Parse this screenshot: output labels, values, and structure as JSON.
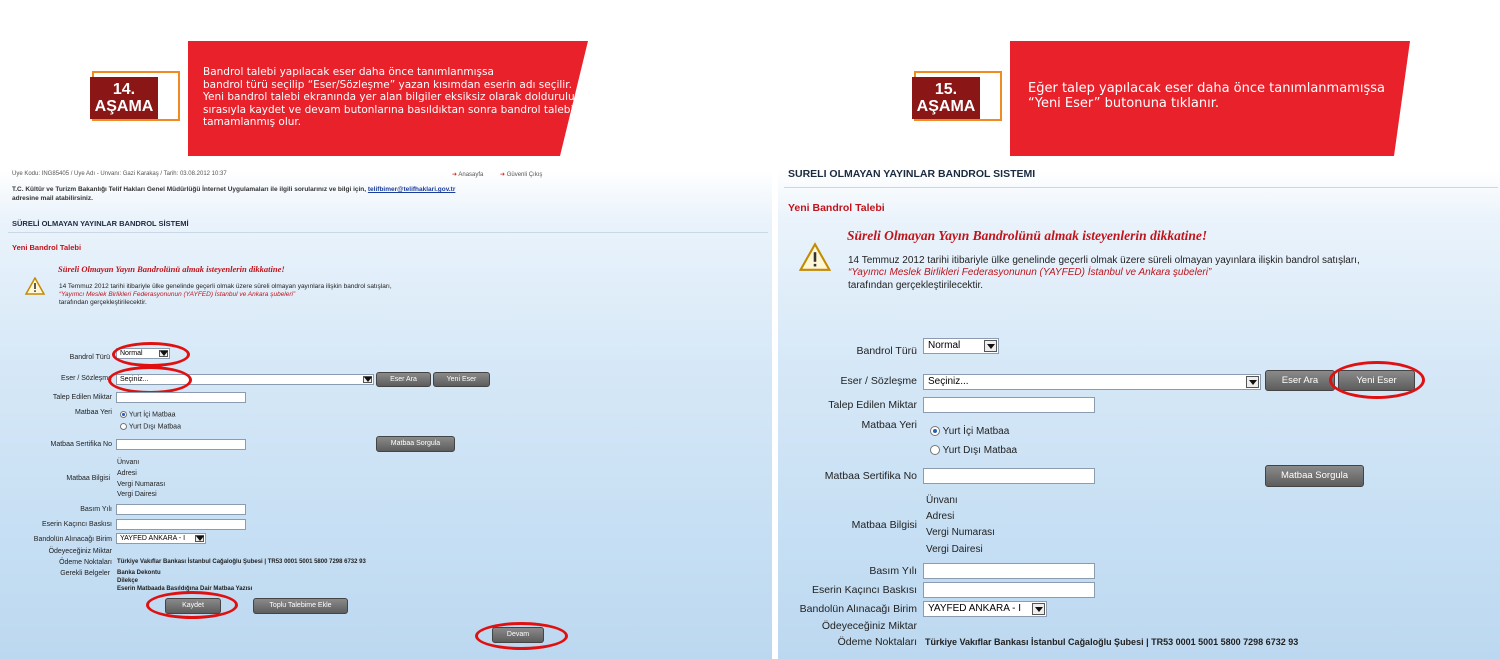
{
  "step14": {
    "badge_num": "14.",
    "badge_text": "AŞAMA",
    "banner": "Bandrol talebi yapılacak eser daha önce tanımlanmışsa\nbandrol türü seçilip “Eser/Sözleşme” yazan kısımdan eserin adı seçilir.\nYeni bandrol talebi ekranında yer alan bilgiler eksiksiz olarak doldurulup\nsırasıyla kaydet ve devam butonlarına basıldıktan sonra bandrol talebi\ntamamlanmış olur."
  },
  "step15": {
    "badge_num": "15.",
    "badge_text": "AŞAMA",
    "banner": "Eğer talep yapılacak eser daha önce tanımlanmamışsa\n“Yeni Eser” butonuna tıklanır."
  },
  "left": {
    "user_info": "Üye Kodu: ING85405 / Üye Adı - Unvanı: Gazi Karakaş / Tarih: 03.08.2012 10:37",
    "nav_home": "Anasayfa",
    "nav_logout": "Güvenli Çıkış",
    "ministry_line1": "T.C. Kültür ve Turizm Bakanlığı Telif Hakları Genel Müdürlüğü İnternet Uygulamaları ile ilgili sorularınız ve bilgi için,",
    "email": "telifbimer@telifhaklari.gov.tr",
    "ministry_line2": "adresine mail atabilirsiniz.",
    "system_title": "SÜRELİ OLMAYAN YAYINLAR BANDROL SİSTEMİ",
    "section_title": "Yeni Bandrol Talebi",
    "notice_title": "Süreli Olmayan Yayın Bandrolünü almak isteyenlerin dikkatine!",
    "notice_line1": "14 Temmuz 2012 tarihi itibariyle ülke genelinde geçerli olmak üzere süreli olmayan yayınlara ilişkin bandrol satışları,",
    "notice_line2": "“Yayımcı Meslek Birlikleri Federasyonunun (YAYFED) İstanbul ve Ankara şubeleri”",
    "notice_line3": "tarafından gerçekleştirilecektir.",
    "bandrol_turu_label": "Bandrol Türü",
    "bandrol_turu_value": "Normal",
    "eser_label": "Eser / Sözleşme",
    "eser_value": "Seçiniz...",
    "eser_ara": "Eser Ara",
    "yeni_eser": "Yeni Eser",
    "talep_label": "Talep Edilen Miktar",
    "matbaa_yeri_label": "Matbaa Yeri",
    "yurt_ici": "Yurt İçi Matbaa",
    "yurt_disi": "Yurt Dışı Matbaa",
    "sertifika_label": "Matbaa Sertifika No",
    "matbaa_sorgula": "Matbaa Sorgula",
    "matbaa_bilgisi_label": "Matbaa Bilgisi",
    "unvani": "Ünvanı",
    "adresi": "Adresi",
    "vergi_no": "Vergi Numarası",
    "vergi_dairesi": "Vergi Dairesi",
    "basim_yili_label": "Basım Yılı",
    "baski_label": "Eserin Kaçıncı Baskısı",
    "birim_label": "Bandolün Alınacağı Birim",
    "birim_value": "YAYFED ANKARA - I",
    "miktar_label": "Ödeyeceğiniz Miktar",
    "odeme_label": "Ödeme Noktaları",
    "odeme_value": "Türkiye Vakıflar Bankası İstanbul Cağaloğlu Şubesi | TR53 0001 5001 5800 7298 6732 93",
    "belgeler_label": "Gerekli Belgeler",
    "belge1": "Banka Dekontu",
    "belge2": "Dilekçe",
    "belge3": "Eserin Matbaada Basıldığına Dair Matbaa Yazısı",
    "kaydet": "Kaydet",
    "toplu": "Toplu Talebime Ekle",
    "devam": "Devam"
  },
  "right": {
    "system_title": "SÜRELİ OLMAYAN YAYINLAR BANDROL SİSTEMİ",
    "section_title": "Yeni Bandrol Talebi",
    "notice_title": "Süreli Olmayan Yayın Bandrolünü almak isteyenlerin dikkatine!",
    "notice_line1": "14 Temmuz 2012 tarihi itibariyle ülke genelinde geçerli olmak üzere süreli olmayan yayınlara ilişkin bandrol satışları,",
    "notice_line2": "“Yayımcı Meslek Birlikleri Federasyonunun (YAYFED) İstanbul ve Ankara şubeleri”",
    "notice_line3": "tarafından gerçekleştirilecektir.",
    "bandrol_turu_label": "Bandrol Türü",
    "bandrol_turu_value": "Normal",
    "eser_label": "Eser / Sözleşme",
    "eser_value": "Seçiniz...",
    "eser_ara": "Eser Ara",
    "yeni_eser": "Yeni Eser",
    "talep_label": "Talep Edilen Miktar",
    "matbaa_yeri_label": "Matbaa Yeri",
    "yurt_ici": "Yurt İçi Matbaa",
    "yurt_disi": "Yurt Dışı Matbaa",
    "sertifika_label": "Matbaa Sertifika No",
    "matbaa_sorgula": "Matbaa Sorgula",
    "matbaa_bilgisi_label": "Matbaa Bilgisi",
    "unvani": "Ünvanı",
    "adresi": "Adresi",
    "vergi_no": "Vergi Numarası",
    "vergi_dairesi": "Vergi Dairesi",
    "basim_yili_label": "Basım Yılı",
    "baski_label": "Eserin Kaçıncı Baskısı",
    "birim_label": "Bandolün Alınacağı Birim",
    "birim_value": "YAYFED ANKARA - I",
    "miktar_label": "Ödeyeceğiniz Miktar",
    "odeme_label": "Ödeme Noktaları",
    "odeme_value": "Türkiye Vakıflar Bankası İstanbul Cağaloğlu Şubesi | TR53 0001 5001 5800 7298 6732 93"
  },
  "colors": {
    "banner": "#e8212b",
    "badge": "#8a1616",
    "badge_border": "#f08a22",
    "highlight_ring": "#e01010",
    "section_red": "#c0141c"
  }
}
